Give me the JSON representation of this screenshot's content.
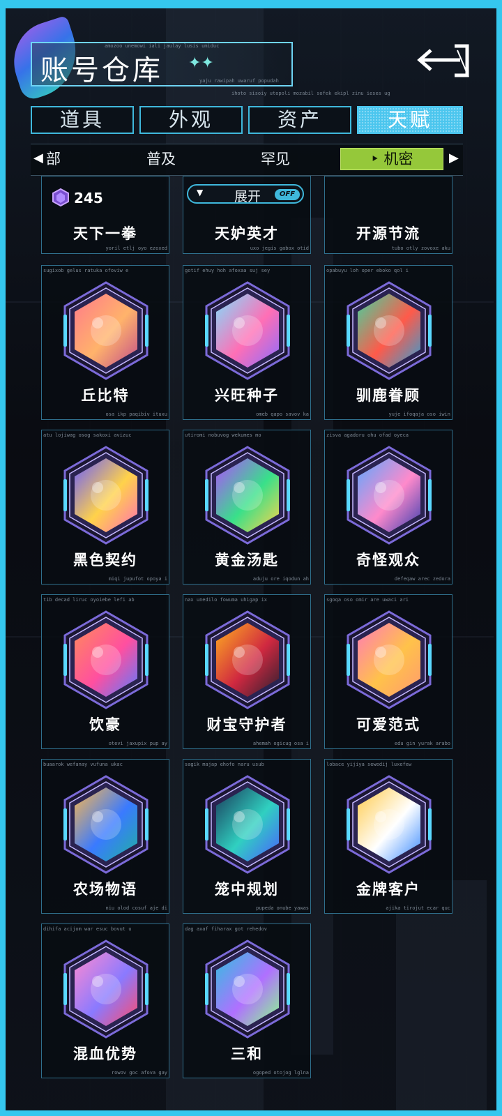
{
  "header": {
    "title": "账号仓库",
    "title_stars": "✦✦",
    "captions": [
      "amozoo unemowi iali jaulay lusis umiduc",
      "yaju rawipah uwaruf popudah",
      "ihoto sisoiy utopoli mozabil sofek ekipl zinu ieses ug"
    ]
  },
  "tabs": [
    {
      "label": "道具",
      "active": false
    },
    {
      "label": "外观",
      "active": false
    },
    {
      "label": "资产",
      "active": false
    },
    {
      "label": "天赋",
      "active": true
    }
  ],
  "subtabs": {
    "items": [
      "部",
      "普及",
      "罕见",
      "机密"
    ],
    "active": "机密",
    "active_marker": "‣"
  },
  "expand": {
    "label": "展开",
    "state": "OFF"
  },
  "count_badge": {
    "value": "245"
  },
  "talents_top": [
    {
      "name": "天下一拳",
      "cap_bot": "yoril etlj oyo ezoxed"
    },
    {
      "name": "天妒英才",
      "cap_bot": "uxo jegis gabox otid"
    },
    {
      "name": "开源节流",
      "cap_bot": "tubo otly zovoxe aku"
    }
  ],
  "talents": [
    {
      "name": "丘比特",
      "cap_top": "sugixob gelus ratuka ofoviw e",
      "cap_bot": "osa ikp paqibiv ituxu",
      "icon": "cupid-bow-icon"
    },
    {
      "name": "兴旺种子",
      "cap_top": "gotif ehuy hoh afoxaa suj sey",
      "cap_bot": "omeb qapo savov ka",
      "icon": "thriving-seed-icon"
    },
    {
      "name": "驯鹿眷顾",
      "cap_top": "opabuyu loh oper eboko qol i",
      "cap_bot": "yuje ifoqaja oso iwin",
      "icon": "reindeer-icon"
    },
    {
      "name": "黑色契约",
      "cap_top": "atu lojiwag osog sakoxi avizuc",
      "cap_bot": "miqi jupufot opoya i",
      "icon": "black-contract-icon"
    },
    {
      "name": "黄金汤匙",
      "cap_top": "utiromi nobuvog wekumes mo",
      "cap_bot": "aduju ore iqodun ah",
      "icon": "golden-spoon-icon"
    },
    {
      "name": "奇怪观众",
      "cap_top": "zisva agadoru ohu ofad oyeca",
      "cap_bot": "defeqaw arec zedora",
      "icon": "strange-audience-icon"
    },
    {
      "name": "饮豪",
      "cap_top": "tib decad liruc oyoiebe lefi ab",
      "cap_bot": "otevi jaxupix pup ay",
      "icon": "cocktail-icon"
    },
    {
      "name": "财宝守护者",
      "cap_top": "nax unedilo fowuma uhigap ix",
      "cap_bot": "ahemah ogicug osa i",
      "icon": "treasure-guardian-icon"
    },
    {
      "name": "可爱范式",
      "cap_top": "sgoqa oso omir are uwaci ari",
      "cap_bot": "edu gin yurak arabo",
      "icon": "cute-bunny-icon"
    },
    {
      "name": "农场物语",
      "cap_top": "buaarok wefanay vufuna ukac",
      "cap_bot": "niu olod cosuf aje di",
      "icon": "farm-story-icon"
    },
    {
      "name": "笼中规划",
      "cap_top": "sagik majap ehofo naru usub",
      "cap_bot": "pupeda onube yawas",
      "icon": "cage-plan-icon"
    },
    {
      "name": "金牌客户",
      "cap_top": "lobace yijiya sewedij luxefew",
      "cap_bot": "ajika tirojut ecar quc",
      "icon": "gold-client-icon"
    },
    {
      "name": "混血优势",
      "cap_top": "dihifa acijom war esuc bovut u",
      "cap_bot": "rowov goc afova gay",
      "icon": "hybrid-advantage-icon"
    },
    {
      "name": "三和",
      "cap_top": "dag axaf fiharax got rehedov",
      "cap_bot": "ogoped otojog lglna",
      "icon": "lotus-icon"
    }
  ],
  "colors": {
    "frame": "#35c7ee",
    "tab_active": "#4cc6ee",
    "subtab_active": "#95c83a",
    "card_border": "#2f6f8c"
  }
}
